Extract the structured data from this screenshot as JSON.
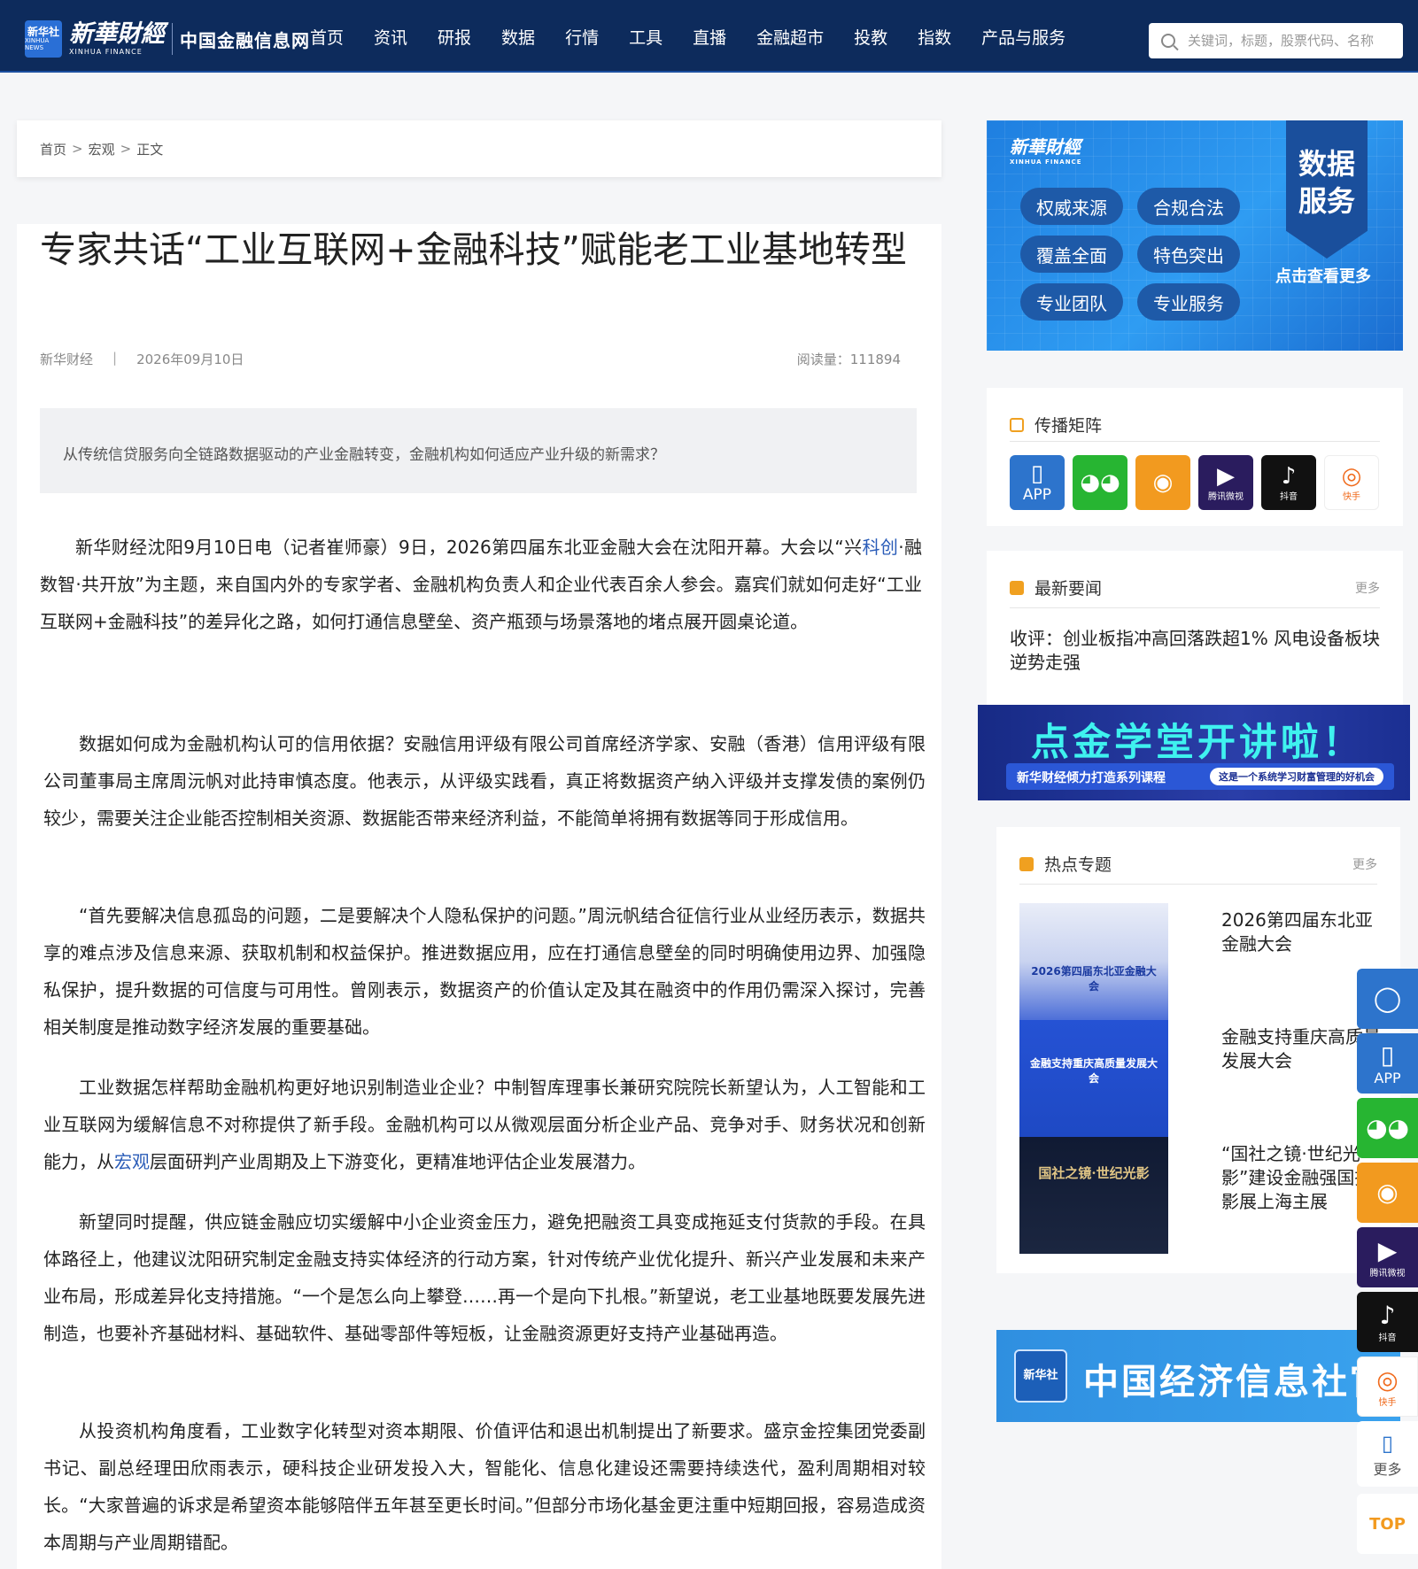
{
  "header": {
    "logo_badge": "新华社",
    "logo_badge_en": "XINHUA NEWS",
    "logo_cn": "新華財經",
    "logo_en": "XINHUA FINANCE",
    "site_name": "中国金融信息网",
    "nav": [
      "首页",
      "资讯",
      "研报",
      "数据",
      "行情",
      "工具",
      "直播",
      "金融超市",
      "投教",
      "指数",
      "产品与服务"
    ],
    "search_placeholder": "关键词，标题，股票代码、名称"
  },
  "breadcrumb": {
    "home": "首页",
    "section": "宏观",
    "current": "正文",
    "separator": ">"
  },
  "article": {
    "title": "专家共话“工业互联网+金融科技”赋能老工业基地转型",
    "source": "新华财经",
    "separator": "|",
    "date": "2026年09月10日",
    "reads_label": "阅读量：",
    "reads": "111894",
    "summary": "从传统信贷服务向全链路数据驱动的产业金融转变，金融机构如何适应产业升级的新需求？",
    "p1_a": "新华财经沈阳9月10日电（记者崔师豪）9日，2026第四届东北亚金融大会在沈阳开幕。大会以“兴",
    "p1_link": "科创",
    "p1_b": "·融数智·共开放”为主题，来自国内外的专家学者、金融机构负责人和企业代表百余人参会。嘉宾们就如何走好“工业互联网+金融科技”的差异化之路，如何打通信息壁垒、资产瓶颈与场景落地的堵点展开圆桌论道。",
    "p2": "数据如何成为金融机构认可的信用依据？安融信用评级有限公司首席经济学家、安融（香港）信用评级有限公司董事局主席周沅帆对此持审慎态度。他表示，从评级实践看，真正将数据资产纳入评级并支撑发债的案例仍较少，需要关注企业能否控制相关资源、数据能否带来经济利益，不能简单将拥有数据等同于形成信用。",
    "p3": "“首先要解决信息孤岛的问题，二是要解决个人隐私保护的问题。”周沅帆结合征信行业从业经历表示，数据共享的难点涉及信息来源、获取机制和权益保护。推进数据应用，应在打通信息壁垒的同时明确使用边界、加强隐私保护，提升数据的可信度与可用性。曾刚表示，数据资产的价值认定及其在融资中的作用仍需深入探讨，完善相关制度是推动数字经济发展的重要基础。",
    "p4_a": "工业数据怎样帮助金融机构更好地识别制造业企业？中制智库理事长兼研究院院长新望认为，人工智能和工业互联网为缓解信息不对称提供了新手段。金融机构可以从微观层面分析企业产品、竞争对手、财务状况和创新能力，从",
    "p4_link": "宏观",
    "p4_b": "层面研判产业周期及上下游变化，更精准地评估企业发展潜力。",
    "p5": "新望同时提醒，供应链金融应切实缓解中小企业资金压力，避免把融资工具变成拖延支付货款的手段。在具体路径上，他建议沈阳研究制定金融支持实体经济的行动方案，针对传统产业优化提升、新兴产业发展和未来产业布局，形成差异化支持措施。“一个是怎么向上攀登……再一个是向下扎根。”新望说，老工业基地既要发展先进制造，也要补齐基础材料、基础软件、基础零部件等短板，让金融资源更好支持产业基础再造。",
    "p6": "从投资机构角度看，工业数字化转型对资本期限、价值评估和退出机制提出了新要求。盛京金控集团党委副书记、副总经理田欣雨表示，硬科技企业研发投入大，智能化、信息化建设还需要持续迭代，盈利周期相对较长。“大家普遍的诉求是希望资本能够陪伴五年甚至更长时间。”但部分市场化基金更注重中短期回报，容易造成资本周期与产业周期错配。"
  },
  "sidebar": {
    "data_ad": {
      "logo": "新華財經",
      "logo_en": "XINHUA FINANCE",
      "tags": [
        "权威来源",
        "合规合法",
        "覆盖全面",
        "特色突出",
        "专业团队",
        "专业服务"
      ],
      "ribbon": "数据服务",
      "more": "点击查看更多"
    },
    "matrix": {
      "title": "传播矩阵",
      "items": [
        {
          "name": "APP",
          "label": "APP",
          "glyph": "▯"
        },
        {
          "name": "wechat",
          "label": "",
          "glyph": "◕◕"
        },
        {
          "name": "weibo",
          "label": "",
          "glyph": "◉"
        },
        {
          "name": "tencent-video",
          "label": "腾讯微视",
          "glyph": "▶"
        },
        {
          "name": "douyin",
          "label": "抖音",
          "glyph": "♪"
        },
        {
          "name": "kuaishou",
          "label": "快手",
          "glyph": "◎"
        }
      ]
    },
    "news": {
      "title": "最新要闻",
      "more": "更多",
      "items": [
        "收评：创业板指冲高回落跌超1% 风电设备板块逆势走强"
      ]
    },
    "school_ad": {
      "title": "点金学堂开讲啦！",
      "subtitle": "新华财经倾力打造系列课程",
      "tagline": "这是一个系统学习财富管理的好机会"
    },
    "topics": {
      "title": "热点专题",
      "more": "更多",
      "items": [
        {
          "text": "2026第四届东北亚金融大会",
          "caption": "2026第四届东北亚金融大会"
        },
        {
          "text": "金融支持重庆高质量发展大会",
          "caption": "金融支持重庆高质量发展大会"
        },
        {
          "text": "“国社之镜·世纪光影”建设金融强国摄影展上海主展",
          "caption": "国社之镜·世纪光影"
        }
      ]
    },
    "eco_ad": {
      "seal": "新华社",
      "text": "中国经济信息社官"
    }
  },
  "floatbar": {
    "items": [
      {
        "name": "user",
        "label": "",
        "glyph": "◯"
      },
      {
        "name": "app",
        "label": "APP",
        "glyph": "▯"
      },
      {
        "name": "wechat",
        "label": "",
        "glyph": "◕◕"
      },
      {
        "name": "weibo",
        "label": "",
        "glyph": "◉"
      },
      {
        "name": "tencent-video",
        "label": "腾讯微视",
        "glyph": "▶"
      },
      {
        "name": "douyin",
        "label": "抖音",
        "glyph": "♪"
      },
      {
        "name": "kuaishou",
        "label": "快手",
        "glyph": "◎"
      },
      {
        "name": "more",
        "label": "更多",
        "glyph": "▯"
      }
    ],
    "top_label": "TOP"
  }
}
